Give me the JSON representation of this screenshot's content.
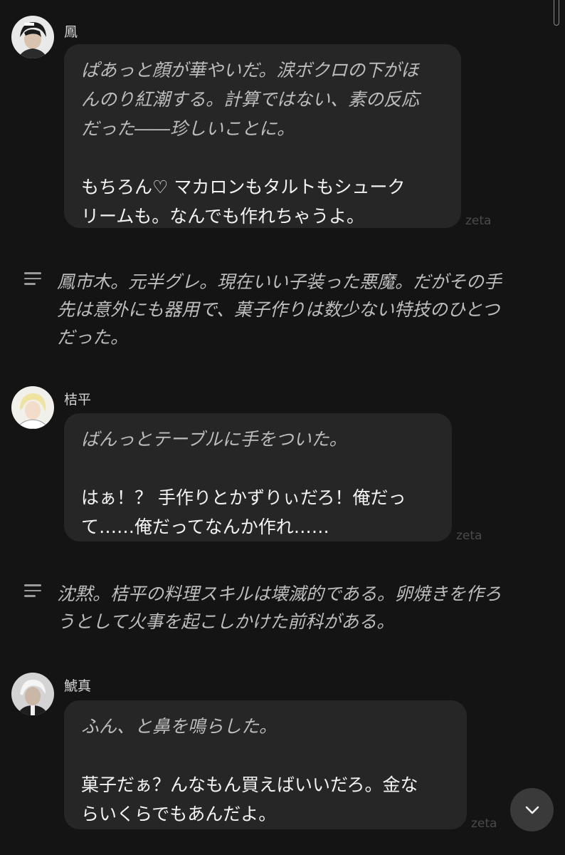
{
  "messages": [
    {
      "name": "鳳",
      "action_lines": [
        "ぱあっと顔が華やいだ。涙ボクロの下がほ",
        "んのり紅潮する。計算ではない、素の反応",
        "だった――珍しいことに。"
      ],
      "speech_lines": [
        "もちろん♡ マカロンもタルトもシューク",
        "リームも。なんでも作れちゃうよ。"
      ],
      "footer": "zeta"
    },
    {
      "name": "桔平",
      "action_lines": [
        "ばんっとテーブルに手をついた。"
      ],
      "speech_lines": [
        "はぁ！？ 手作りとかずりぃだろ！俺だっ",
        "て……俺だってなんか作れ……"
      ],
      "footer": "zeta"
    },
    {
      "name": "鯱真",
      "action_lines": [
        "ふん、と鼻を鳴らした。"
      ],
      "speech_lines": [
        "菓子だぁ？んなもん買えばいいだろ。金な",
        "らいくらでもあんだよ。"
      ],
      "footer": "zeta"
    }
  ],
  "narrations": [
    {
      "lines": [
        "鳳市木。元半グレ。現在いい子装った悪魔。だがその手",
        "先は意外にも器用で、菓子作りは数少ない特技のひとつ",
        "だった。"
      ]
    },
    {
      "lines": [
        "沈黙。桔平の料理スキルは壊滅的である。卵焼きを作ろ",
        "うとして火事を起こしかけた前科がある。"
      ]
    }
  ],
  "icons": {
    "narration": "menu-lines-icon",
    "scroll": "chevron-down-icon"
  },
  "colors": {
    "background": "#141414",
    "bubble": "#262626",
    "scroll_button": "#3a3a3a"
  }
}
